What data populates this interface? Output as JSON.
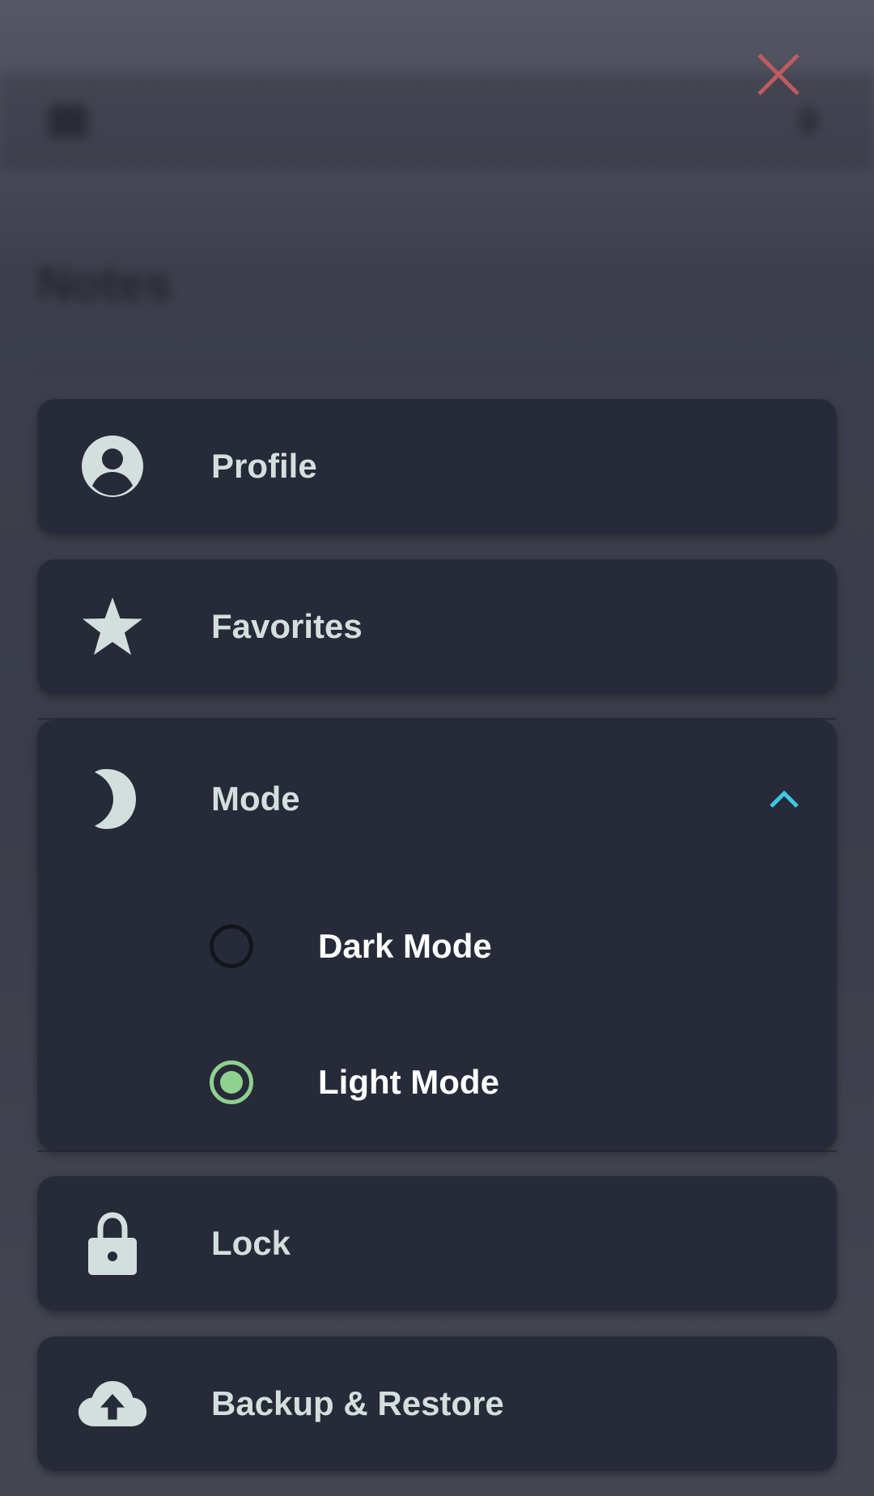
{
  "background": {
    "title": "Notes"
  },
  "menu": {
    "close_icon": "close-icon",
    "items": [
      {
        "label": "Profile",
        "icon": "account-circle-icon"
      },
      {
        "label": "Favorites",
        "icon": "star-icon"
      },
      {
        "label": "Mode",
        "icon": "moon-icon",
        "expanded": true
      },
      {
        "label": "Lock",
        "icon": "lock-icon"
      },
      {
        "label": "Backup & Restore",
        "icon": "cloud-upload-icon"
      }
    ],
    "mode_options": [
      {
        "label": "Dark Mode",
        "selected": false
      },
      {
        "label": "Light Mode",
        "selected": true
      }
    ]
  },
  "colors": {
    "card": "#272a38",
    "label": "#d3dfdc",
    "close": "#c05a5f",
    "chevron": "#3fc6e6",
    "radio_selected": "#8fd18f",
    "radio_unselected": "#14151b"
  }
}
